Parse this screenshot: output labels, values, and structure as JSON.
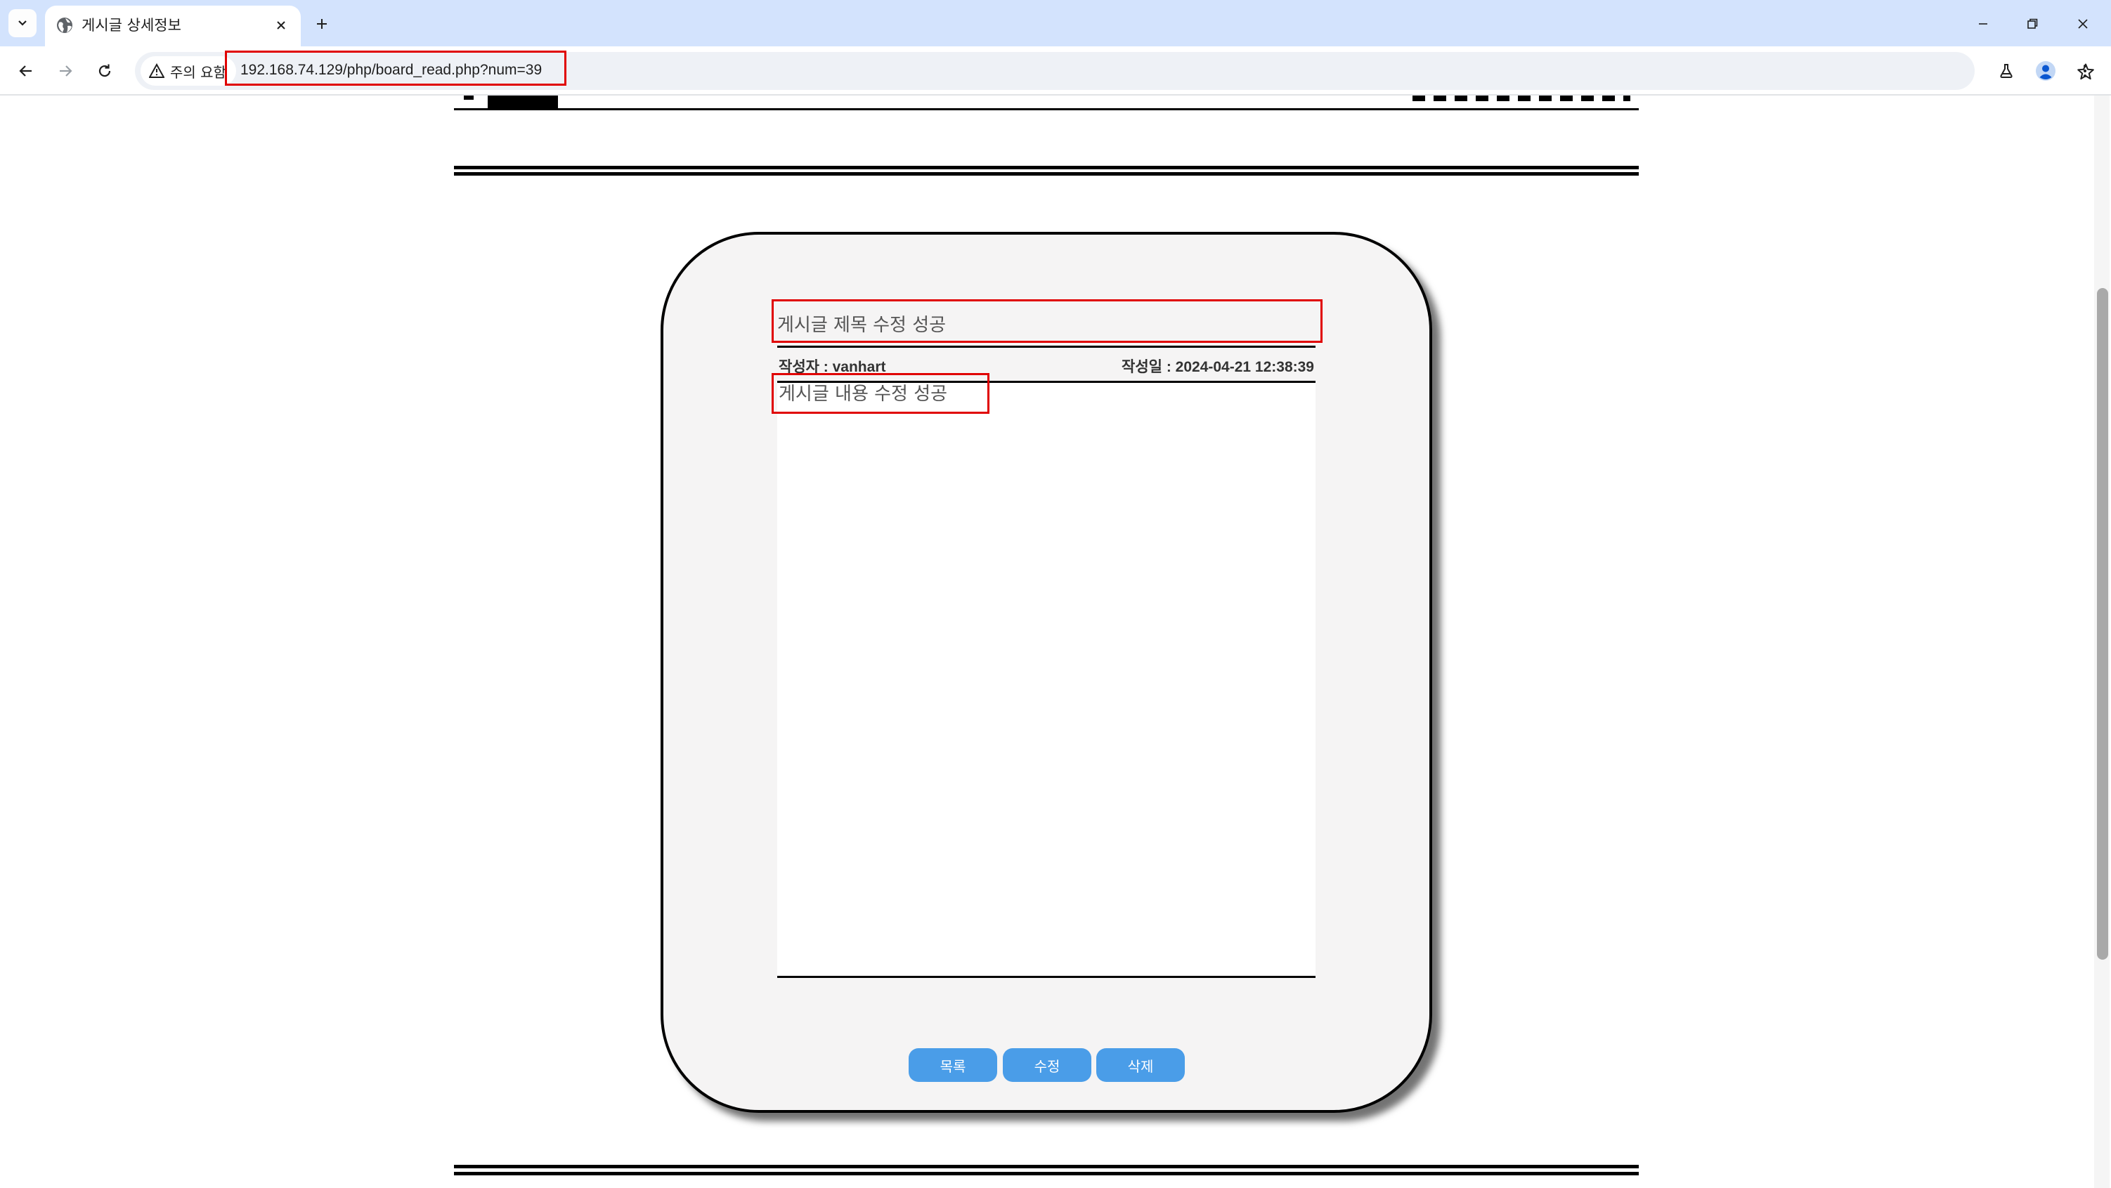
{
  "browser": {
    "tab": {
      "title": "게시글 상세정보",
      "favicon": "globe-icon"
    },
    "security_chip": "주의 요함",
    "url": "192.168.74.129/php/board_read.php?num=39"
  },
  "post": {
    "title": "게시글 제목 수정 성공",
    "author_label": "작성자 : ",
    "author": "vanhart",
    "date_label": "작성일 : ",
    "date": "2024-04-21 12:38:39",
    "content": "게시글 내용 수정 성공"
  },
  "buttons": {
    "list": "목록",
    "edit": "수정",
    "delete": "삭제"
  },
  "colors": {
    "button": "#4a9de8",
    "annotation": "#e00000",
    "card_background": "#f5f4f4"
  }
}
